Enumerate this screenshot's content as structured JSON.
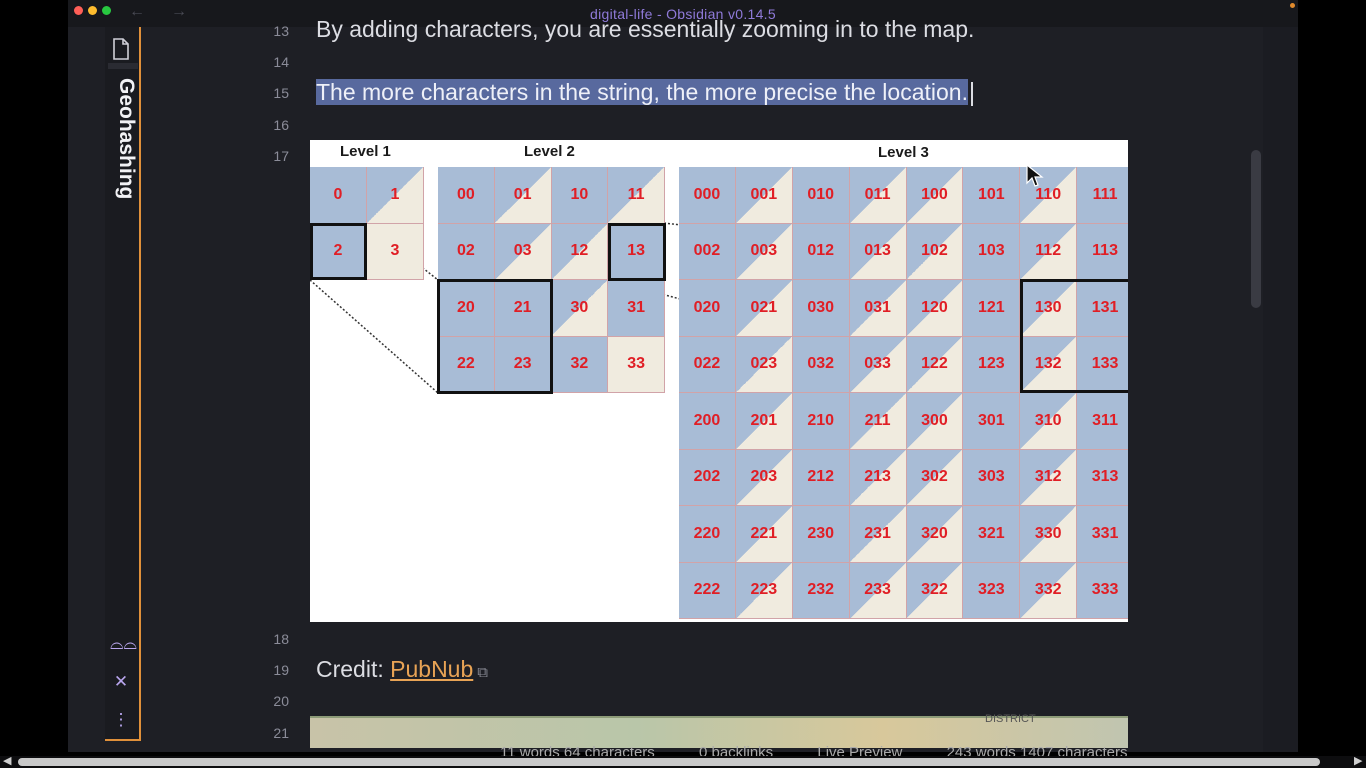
{
  "window": {
    "title": "digital-life - Obsidian v0.14.5",
    "back_glyph": "←",
    "forward_glyph": "→"
  },
  "sidebar": {
    "title": "Geohashing",
    "icons": [
      "file-icon",
      "glasses-icon",
      "close-icon",
      "more-options-icon"
    ],
    "glyphs": {
      "glasses": "⌓⌓",
      "close": "✕",
      "more": "⋮"
    }
  },
  "editor": {
    "lines": [
      {
        "num": "13",
        "text": "By adding characters, you are essentially zooming in to the map."
      },
      {
        "num": "14",
        "text": ""
      },
      {
        "num": "15",
        "text": "The more characters in the string, the more precise the location."
      },
      {
        "num": "16",
        "text": ""
      },
      {
        "num": "17",
        "text": ""
      },
      {
        "num": "18",
        "text": ""
      },
      {
        "num": "19",
        "text": ""
      },
      {
        "num": "20",
        "text": ""
      },
      {
        "num": "21",
        "text": ""
      }
    ],
    "credit_label": "Credit: ",
    "credit_link": "PubNub",
    "ext_glyph": "⧉"
  },
  "figure": {
    "level1": {
      "label": "Level 1",
      "cells": [
        "0",
        "1",
        "2",
        "3"
      ]
    },
    "level2": {
      "label": "Level 2",
      "cells": [
        "00",
        "01",
        "10",
        "11",
        "02",
        "03",
        "12",
        "13",
        "20",
        "21",
        "30",
        "31",
        "22",
        "23",
        "32",
        "33"
      ]
    },
    "level3": {
      "label": "Level 3",
      "cells": [
        "000",
        "001",
        "010",
        "011",
        "100",
        "101",
        "110",
        "111",
        "002",
        "003",
        "012",
        "013",
        "102",
        "103",
        "112",
        "113",
        "020",
        "021",
        "030",
        "031",
        "120",
        "121",
        "130",
        "131",
        "022",
        "023",
        "032",
        "033",
        "122",
        "123",
        "132",
        "133",
        "200",
        "201",
        "210",
        "211",
        "300",
        "301",
        "310",
        "311",
        "202",
        "203",
        "212",
        "213",
        "302",
        "303",
        "312",
        "313",
        "220",
        "221",
        "230",
        "231",
        "320",
        "321",
        "330",
        "331",
        "222",
        "223",
        "232",
        "233",
        "322",
        "323",
        "332",
        "333"
      ]
    }
  },
  "map_preview": {
    "label": "DISTRICT"
  },
  "status_bar": {
    "items": [
      "11 words 64 characters",
      "0 backlinks",
      "Live Preview",
      "243 words 1407 characters"
    ]
  }
}
